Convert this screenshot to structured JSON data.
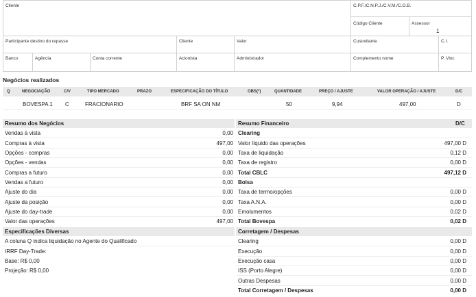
{
  "header": {
    "cliente": "Cliente",
    "cpf_cnpj": "C.P.F./C.N.P.J./C.V.M./C.O.B.",
    "codigo_cliente": "Código Cliente",
    "assessor": "Assessor",
    "assessor_value": "1",
    "participante": "Participante destino do repasse",
    "cliente2": "Cliente",
    "valor": "Valor",
    "custodiante": "Custodiante",
    "ci": "C.I.",
    "banco": "Banco",
    "agencia": "Agência",
    "conta_corrente": "Conta corrente",
    "acionista": "Acionista",
    "administrador": "Administrador",
    "complemento_nome": "Complemento nome",
    "p_vinc": "P. Vinc"
  },
  "negocios": {
    "title": "Negócios realizados",
    "columns": [
      "Q",
      "NEGOCIAÇÃO",
      "C/V",
      "TIPO MERCADO",
      "PRAZO",
      "ESPECIFICAÇÃO DO TÍTULO",
      "OBS(*)",
      "QUANTIDADE",
      "PREÇO / AJUSTE",
      "VALOR OPERAÇÃO / AJUSTE",
      "D/C"
    ],
    "row": {
      "negociacao": "BOVESPA 1",
      "cv": "C",
      "tipo_mercado": "FRACIONARIO",
      "especificacao": "BRF SA ON NM",
      "quantidade": "50",
      "preco": "9,94",
      "valor_operacao": "497,00",
      "dc": "D"
    }
  },
  "resumo_negocios": {
    "title": "Resumo dos Negócios",
    "rows": [
      {
        "label": "Vendas à vista",
        "value": "0,00"
      },
      {
        "label": "Compras à vista",
        "value": "497,00"
      },
      {
        "label": "Opções - compras",
        "value": "0,00"
      },
      {
        "label": "Opções - vendas",
        "value": "0,00"
      },
      {
        "label": "Compras a futuro",
        "value": "0,00"
      },
      {
        "label": "Vendas a futuro",
        "value": "0,00"
      },
      {
        "label": "Ajuste do dia",
        "value": "0,00"
      },
      {
        "label": "Ajuste da posição",
        "value": "0,00"
      },
      {
        "label": "Ajuste do day-trade",
        "value": "0,00"
      },
      {
        "label": "Valor das operações",
        "value": "497,00"
      }
    ]
  },
  "resumo_financeiro": {
    "title": "Resumo Financeiro",
    "dc": "D/C",
    "clearing_title": "Clearing",
    "clearing_rows": [
      {
        "label": "Valor líquido das operações",
        "value": "497,00 D"
      },
      {
        "label": "Taxa de liquidação",
        "value": "0,12 D"
      },
      {
        "label": "Taxa de registro",
        "value": "0,00 D"
      }
    ],
    "total_cblc_label": "Total CBLC",
    "total_cblc_value": "497,12 D",
    "bolsa_title": "Bolsa",
    "bolsa_rows": [
      {
        "label": "Taxa de termo/opções",
        "value": "0,00 D"
      },
      {
        "label": "Taxa A.N.A.",
        "value": "0,00 D"
      },
      {
        "label": "Emolumentos",
        "value": "0,02 D"
      }
    ],
    "total_bovespa_label": "Total Bovespa",
    "total_bovespa_value": "0,02 D"
  },
  "especificacoes": {
    "title": "Especificações Diversas",
    "lines": [
      "A coluna Q indica liquidação no Agente do Qualificado",
      "IRRF Day-Trade:",
      "Base: R$ 0,00",
      "Projeção: R$ 0,00"
    ]
  },
  "corretagem": {
    "title": "Corretagem / Despesas",
    "rows": [
      {
        "label": "Clearing",
        "value": "0,00 D"
      },
      {
        "label": "Execução",
        "value": "0,00 D"
      },
      {
        "label": "Execução casa",
        "value": "0,00 D"
      },
      {
        "label": "ISS (Porto Alegre)",
        "value": "0,00 D"
      },
      {
        "label": "Outras Despesas",
        "value": "0,00 D"
      }
    ],
    "total_label": "Total Corretagem / Despesas",
    "total_value": "0,00 D"
  }
}
